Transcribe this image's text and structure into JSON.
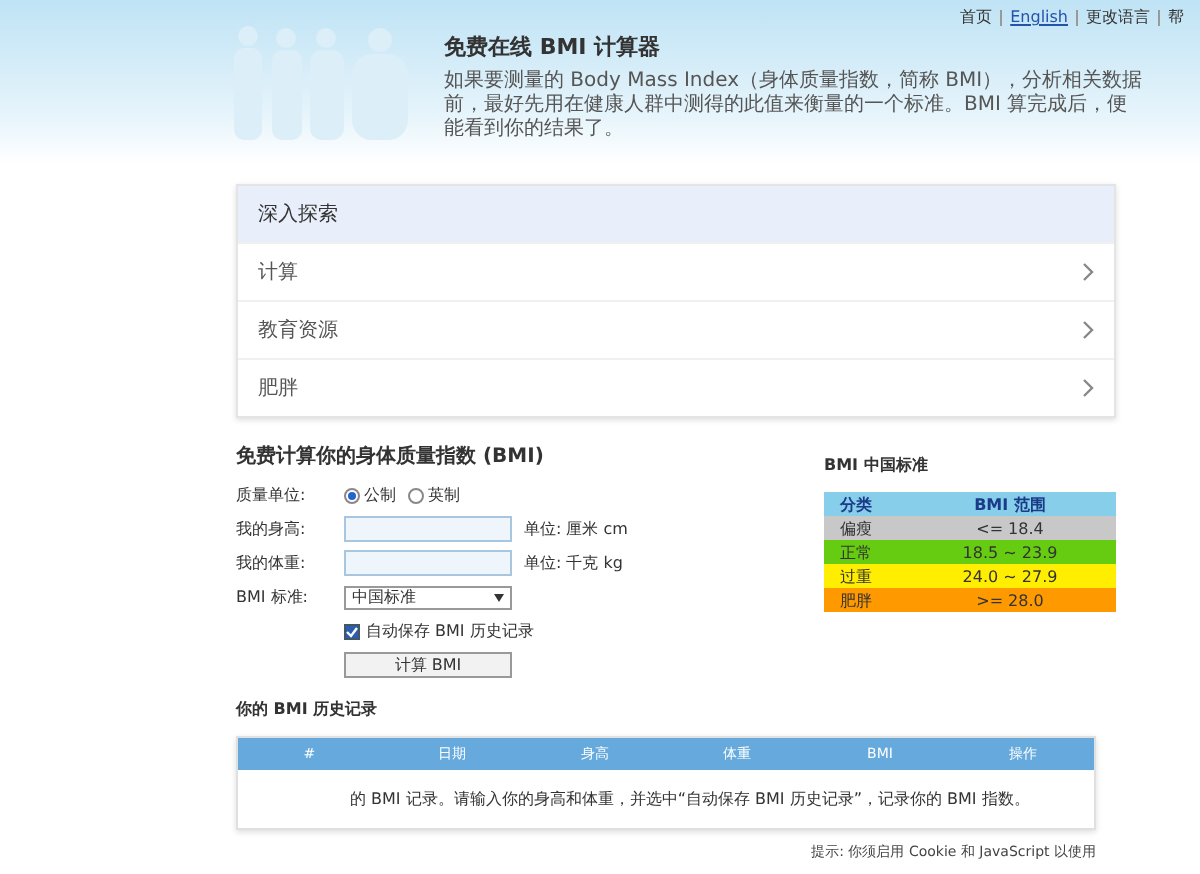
{
  "top_links": [
    "首页",
    "English",
    "更改语言",
    "帮"
  ],
  "header": {
    "title": "免费在线 BMI 计算器",
    "description": "如果要测量的 Body Mass Index（身体质量指数，简称 BMI），分析相关数据前，最好先用在健康人群中测得的此值来衡量的一个标准。BMI 算完成后，便能看到你的结果了。"
  },
  "explore": {
    "title": "深入探索",
    "items": [
      {
        "label": "计算"
      },
      {
        "label": "教育资源"
      },
      {
        "label": "肥胖"
      }
    ]
  },
  "form": {
    "title": "免费计算你的身体质量指数 (BMI)",
    "unit_label": "质量单位:",
    "units": [
      {
        "label": "公制",
        "selected": true
      },
      {
        "label": "英制",
        "selected": false
      }
    ],
    "height_label": "我的身高:",
    "height_unit": "单位: 厘米 cm",
    "weight_label": "我的体重:",
    "weight_unit": "单位: 千克 kg",
    "standard_label": "BMI 标准:",
    "standard_value": "中国标准",
    "autosave": {
      "label": "自动保存 BMI 历史记录",
      "checked": true
    },
    "button": "计算 BMI"
  },
  "standard": {
    "title": "BMI 中国标准",
    "columns": [
      "分类",
      "BMI 范围"
    ],
    "rows": [
      {
        "category": "偏瘦",
        "range": "<= 18.4",
        "color": "#c8c8c8"
      },
      {
        "category": "正常",
        "range": "18.5 ~ 23.9",
        "color": "#66cc11"
      },
      {
        "category": "过重",
        "range": "24.0 ~ 27.9",
        "color": "#ffee00"
      },
      {
        "category": "肥胖",
        "range": ">= 28.0",
        "color": "#ff9900"
      }
    ]
  },
  "history": {
    "title": "你的 BMI 历史记录",
    "columns": [
      "#",
      "日期",
      "身高",
      "体重",
      "BMI",
      "操作"
    ],
    "message": "的 BMI 记录。请输入你的身高和体重，并选中“自动保存 BMI 历史记录”，记录你的 BMI 指数。",
    "note": "提示: 你须启用 Cookie 和 JavaScript 以使用"
  }
}
